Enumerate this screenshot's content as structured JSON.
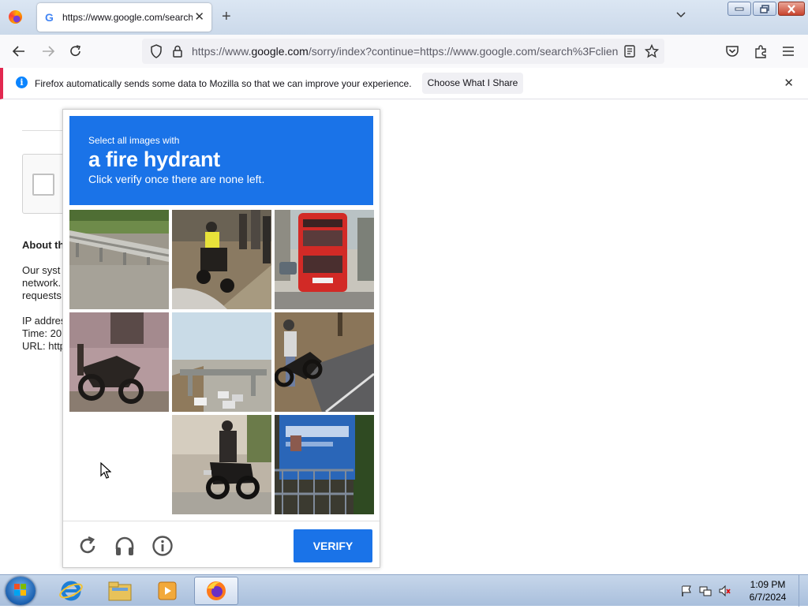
{
  "browser": {
    "tab_title": "https://www.google.com/search",
    "url_prefix": "https://www.",
    "url_domain": "google.com",
    "url_rest": "/sorry/index?continue=https://www.google.com/search%3Fclient",
    "infobar_text": "Firefox automatically sends some data to Mozilla so that we can improve your experience.",
    "infobar_button": "Choose What I Share"
  },
  "background_page": {
    "heading": "About th",
    "lines": [
      "Our syst",
      "network.",
      "requests"
    ],
    "ip_line": "IP addres",
    "time_line": "Time: 20",
    "url_line": "URL: http"
  },
  "captcha": {
    "instruction_small": "Select all images with",
    "target": "a fire hydrant",
    "instruction_sub": "Click verify once there are none left.",
    "verify_label": "VERIFY",
    "tiles": [
      {
        "name": "tile-guardrail-road",
        "empty": false
      },
      {
        "name": "tile-motorcycle-riders",
        "empty": false
      },
      {
        "name": "tile-red-bus",
        "empty": false
      },
      {
        "name": "tile-motorcycle-wall",
        "empty": false
      },
      {
        "name": "tile-highway-overpass",
        "empty": false
      },
      {
        "name": "tile-person-motorcycle",
        "empty": false
      },
      {
        "name": "tile-empty",
        "empty": true
      },
      {
        "name": "tile-motorcycle-rider-street",
        "empty": false
      },
      {
        "name": "tile-blue-sign",
        "empty": false
      }
    ],
    "accent_color": "#1a73e8"
  },
  "taskbar": {
    "time": "1:09 PM",
    "date": "6/7/2024"
  }
}
